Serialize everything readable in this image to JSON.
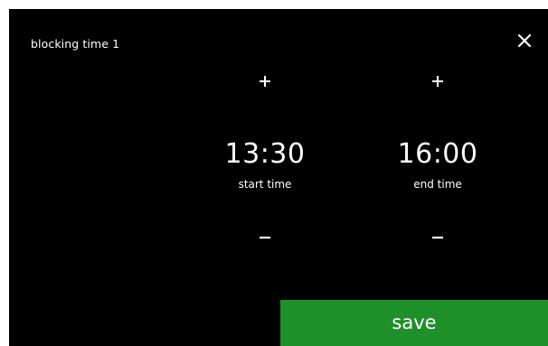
{
  "dialog": {
    "title": "blocking time 1"
  },
  "start": {
    "value": "13:30",
    "label": "start time"
  },
  "end": {
    "value": "16:00",
    "label": "end time"
  },
  "actions": {
    "save_label": "save"
  },
  "icons": {
    "close": "close-icon",
    "increase": "plus-icon",
    "decrease": "minus-icon"
  },
  "colors": {
    "background": "#000000",
    "text": "#ffffff",
    "save_button": "#1f8f2a"
  }
}
